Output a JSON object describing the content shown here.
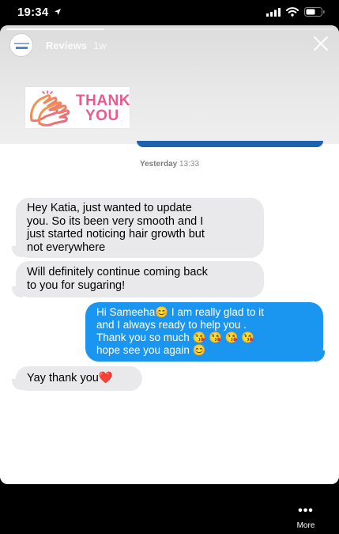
{
  "status_bar": {
    "time": "19:34"
  },
  "story": {
    "account_name": "Reviews",
    "age": "1w",
    "progress": 0.3,
    "sticker": {
      "line1": "THANK",
      "line2": "YOU"
    }
  },
  "conversation": {
    "timestamp_day": "Yesterday",
    "timestamp_time": "13:33",
    "messages": [
      {
        "from": "them",
        "lines": [
          "Hey Katia, just wanted to update",
          "you. So its been very smooth and I",
          "just started noticing hair growth but",
          "not everywhere"
        ]
      },
      {
        "from": "them",
        "lines": [
          "Will definitely continue coming back",
          "to you for sugaring!"
        ]
      },
      {
        "from": "me",
        "lines": [
          "Hi Sameeha😊 I am really glad to it",
          "and I always ready to help you .",
          "Thank you so much 😘 😘 😘 😘",
          "hope see you again 😊"
        ]
      },
      {
        "from": "them",
        "lines": [
          "Yay thank you❤️"
        ]
      }
    ]
  },
  "footer": {
    "more_label": "More"
  },
  "colors": {
    "sent_bubble": "#1a96f1",
    "received_bubble": "#e9e9eb",
    "sticker_pink": "#ea5a8e"
  }
}
